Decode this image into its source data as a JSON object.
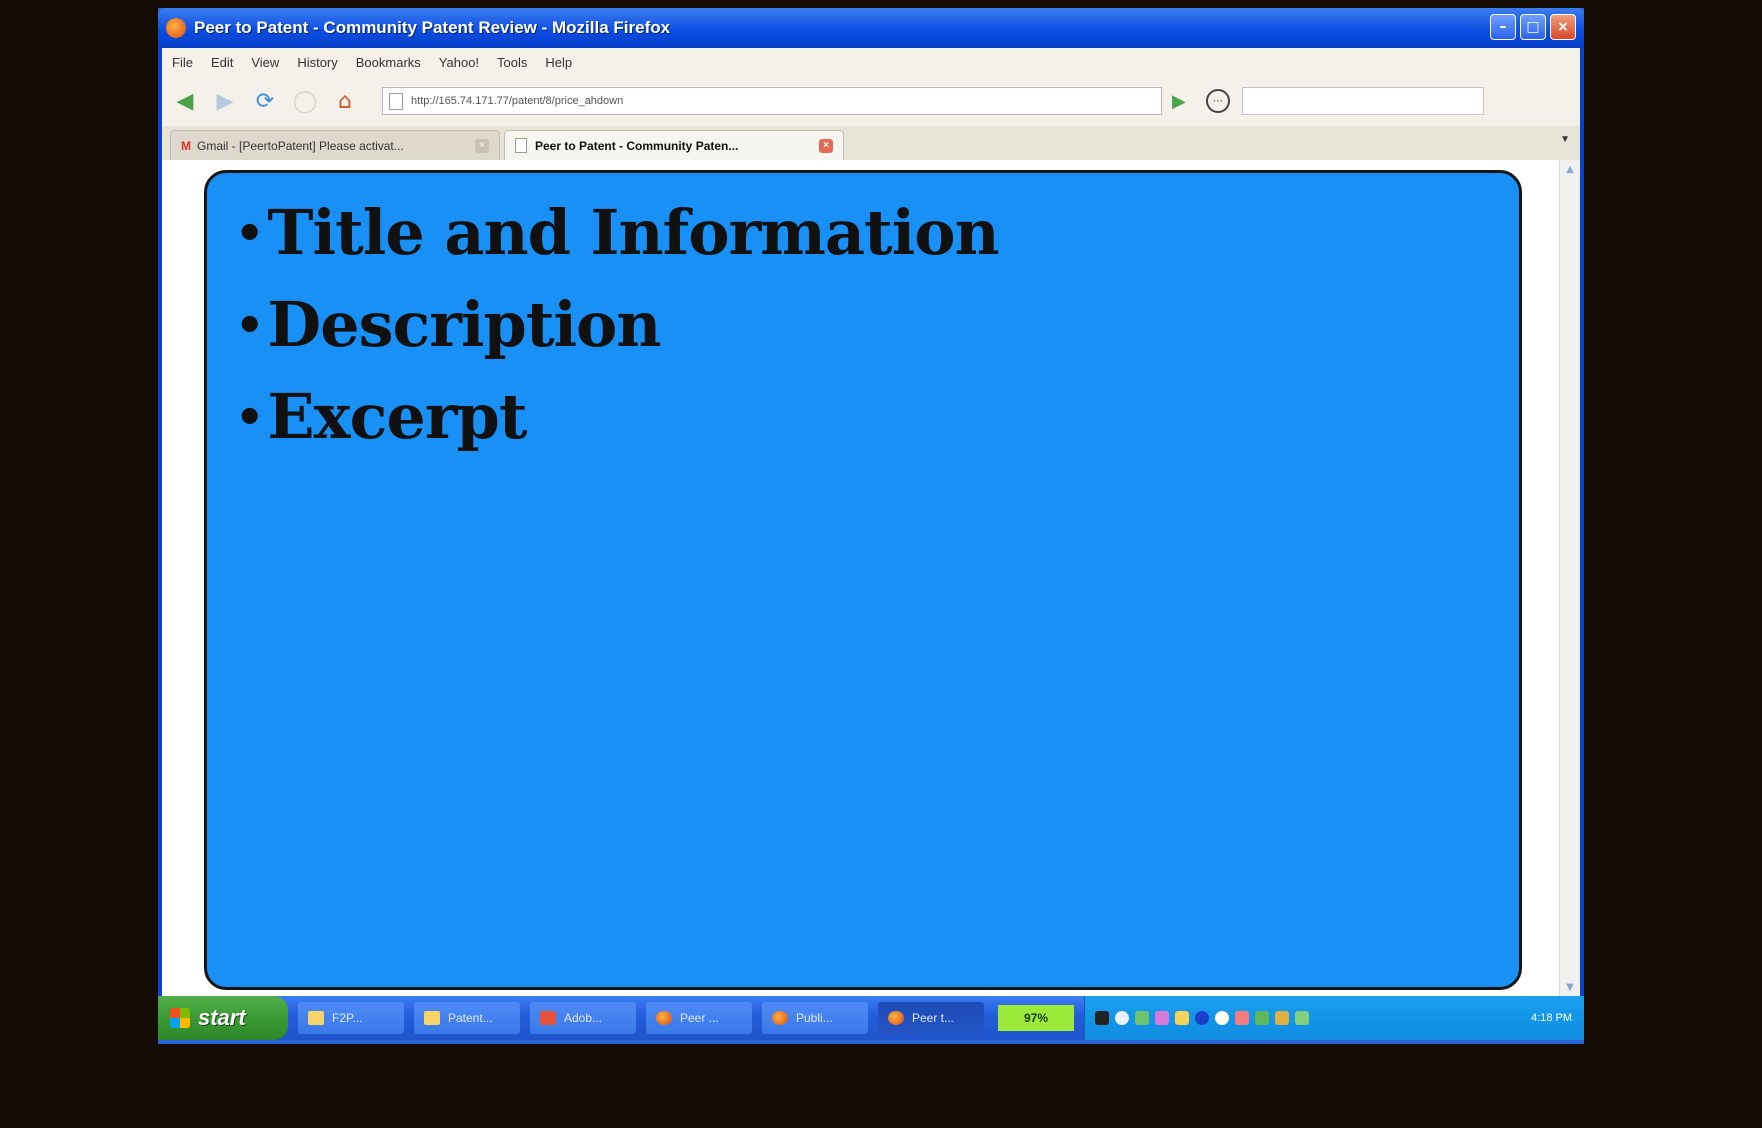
{
  "window": {
    "title": "Peer to Patent - Community Patent Review - Mozilla Firefox",
    "minimize_label": "–",
    "maximize_label": "□",
    "close_label": "×"
  },
  "menu": {
    "items": [
      "File",
      "Edit",
      "View",
      "History",
      "Bookmarks",
      "Yahoo!",
      "Tools",
      "Help"
    ]
  },
  "nav": {
    "url": "http://165.74.171.77/patent/8/price_ahdown",
    "search_placeholder": ""
  },
  "tabs": [
    {
      "label": "Gmail - [PeertoPatent] Please activat...",
      "active": false,
      "icon": "gmail-icon"
    },
    {
      "label": "Peer to Patent - Community Paten...",
      "active": true,
      "icon": "page-icon"
    }
  ],
  "slide": {
    "bullet": "•",
    "items": [
      "Title and Information",
      "Description",
      "Excerpt"
    ],
    "background": "#1890f5"
  },
  "taskbar": {
    "start_label": "start",
    "buttons": [
      {
        "label": "F2P...",
        "icon": "folder",
        "active": false
      },
      {
        "label": "Patent...",
        "icon": "folder",
        "active": false
      },
      {
        "label": "Adob...",
        "icon": "adobe",
        "active": false
      },
      {
        "label": "Peer ...",
        "icon": "firefox",
        "active": false
      },
      {
        "label": "Publi...",
        "icon": "firefox",
        "active": false
      },
      {
        "label": "Peer t...",
        "icon": "firefox",
        "active": true
      }
    ],
    "battery": "97%",
    "clock": "4:18 PM"
  },
  "colors": {
    "accent": "#1890f5",
    "titlebar": "#0a4be0",
    "taskbar": "#245edb",
    "start": "#3a9a33"
  }
}
